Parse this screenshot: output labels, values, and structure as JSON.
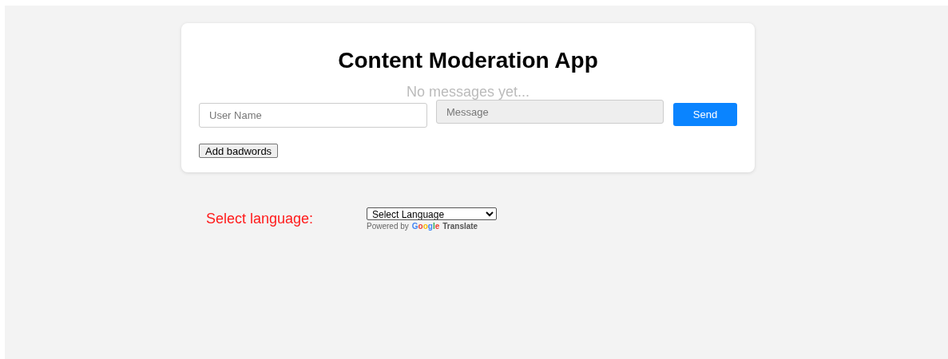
{
  "app": {
    "title": "Content Moderation App",
    "empty_text": "No messages yet...",
    "username_field": {
      "placeholder": "User Name"
    },
    "message_field": {
      "placeholder": "Message"
    },
    "send_button": "Send",
    "badwords_button": "Add badwords"
  },
  "language": {
    "label": "Select language:",
    "select_value": "Select Language",
    "powered_by": "Powered by",
    "google": "Google",
    "translate": "Translate"
  }
}
